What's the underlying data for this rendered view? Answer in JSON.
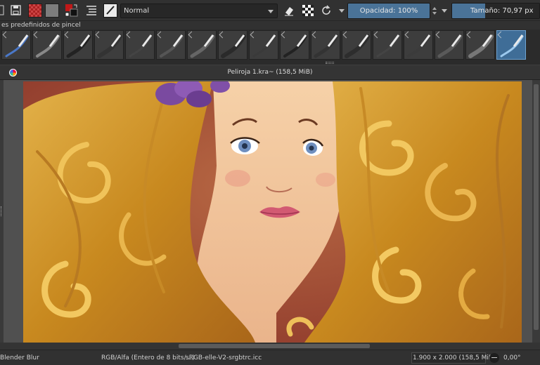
{
  "toolbar": {
    "blend_mode": "Normal",
    "opacity_label": "Opacidad: 100%",
    "opacity_value": 1.0,
    "size_label": "Tamaño: 70,97 px",
    "size_fill": 0.38,
    "icons": [
      "save-icon",
      "pattern-icon",
      "gradient-icon",
      "swap-colors-icon",
      "layer-list-icon",
      "brush-preset-icon",
      "eraser-icon",
      "alpha-lock-icon",
      "reload-preset-icon"
    ]
  },
  "brush_presets": {
    "title": "es predefinidos de pincel",
    "items": [
      {
        "name": "brush-preset-1",
        "selected": false
      },
      {
        "name": "brush-preset-2",
        "selected": false
      },
      {
        "name": "brush-preset-3",
        "selected": false
      },
      {
        "name": "brush-preset-4",
        "selected": false
      },
      {
        "name": "brush-preset-5",
        "selected": false
      },
      {
        "name": "brush-preset-6",
        "selected": false
      },
      {
        "name": "brush-preset-7",
        "selected": false
      },
      {
        "name": "brush-preset-8",
        "selected": false
      },
      {
        "name": "brush-preset-9",
        "selected": false
      },
      {
        "name": "brush-preset-10",
        "selected": false
      },
      {
        "name": "brush-preset-11",
        "selected": false
      },
      {
        "name": "brush-preset-12",
        "selected": false
      },
      {
        "name": "brush-preset-13",
        "selected": false
      },
      {
        "name": "brush-preset-14",
        "selected": false
      },
      {
        "name": "brush-preset-15",
        "selected": false
      },
      {
        "name": "brush-preset-16",
        "selected": false
      },
      {
        "name": "brush-preset-17",
        "selected": true
      }
    ]
  },
  "document": {
    "title": "Peliroja 1.kra~ (158,5 MiB)"
  },
  "status": {
    "brush_name": "Blender Blur",
    "color_model": "RGB/Alfa (Entero de 8 bits/...)",
    "color_profile": "sRGB-elle-V2-srgbtrc.icc",
    "dimensions": "1.900 x 2.000 (158,5 MiB)",
    "rotation": "0,00°"
  },
  "colors": {
    "accent": "#4a7398",
    "selected_preset": "#3f6d97",
    "canvas_background": "#a8503a",
    "hair": "#d49a2c",
    "skin": "#f2c49a"
  }
}
